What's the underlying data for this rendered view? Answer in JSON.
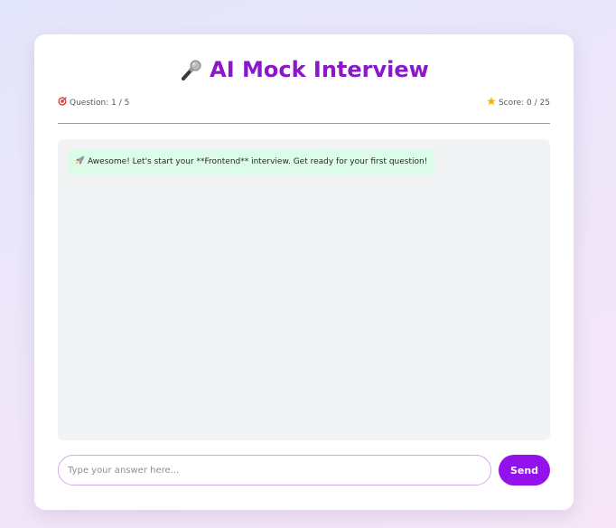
{
  "header": {
    "title": "AI Mock Interview",
    "title_icon": "microphone-icon",
    "accent_color": "#8a18c9"
  },
  "status": {
    "question_icon": "target-icon",
    "question_text": "Question: 1 / 5",
    "score_icon": "star-icon",
    "score_text": "Score: 0 / 25"
  },
  "chat": {
    "messages": [
      {
        "icon": "rocket-icon",
        "text": "Awesome! Let's start your **Frontend** interview. Get ready for your first question!",
        "bubble_color": "#dcfce7"
      }
    ]
  },
  "composer": {
    "placeholder": "Type your answer here...",
    "value": "",
    "send_label": "Send",
    "send_color": "#9311ea"
  }
}
